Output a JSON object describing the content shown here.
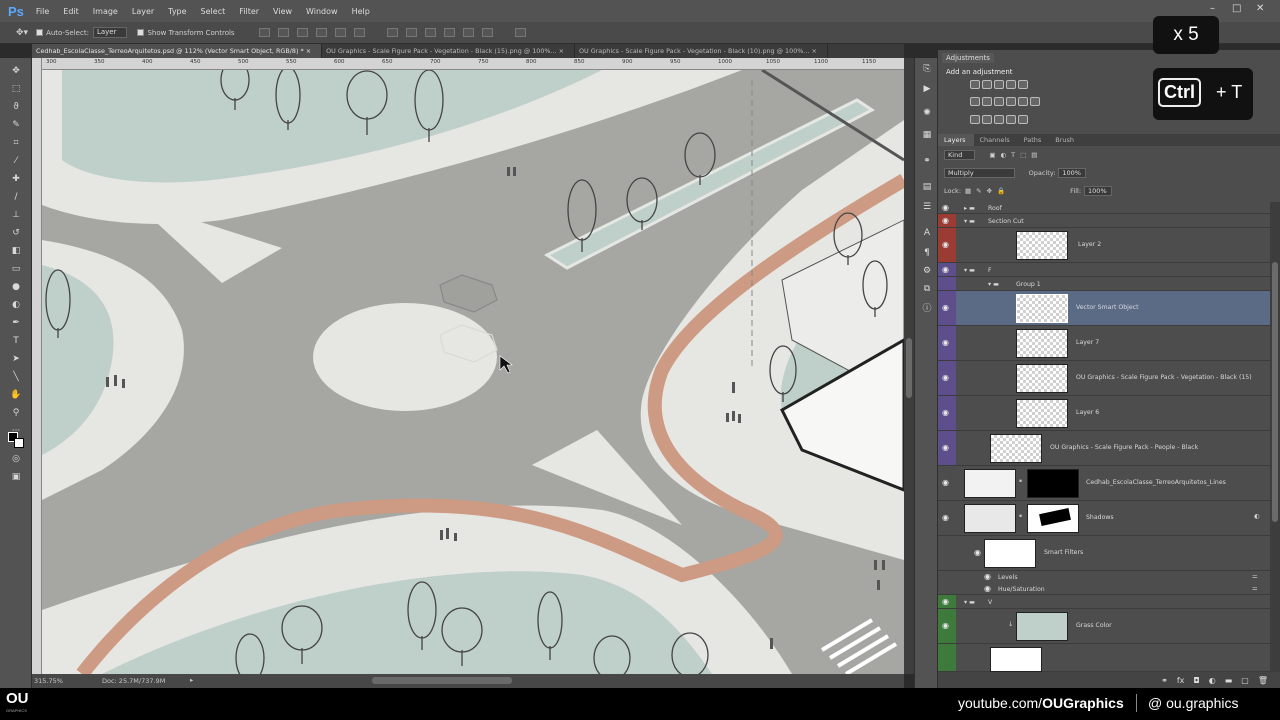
{
  "app": {
    "logo": "Ps"
  },
  "menu": [
    "File",
    "Edit",
    "Image",
    "Layer",
    "Type",
    "Select",
    "Filter",
    "View",
    "Window",
    "Help"
  ],
  "options": {
    "auto_select_label": "Auto-Select:",
    "auto_select_value": "Layer",
    "show_transform_label": "Show Transform Controls"
  },
  "doc_tabs": [
    "Cedhab_EscolaClasse_TerreoArquitetos.psd @ 112% (Vector Smart Object, RGB/8) *",
    "OU Graphics - Scale Figure Pack - Vegetation - Black (15).png @ 100%...",
    "OU Graphics - Scale Figure Pack - Vegetation - Black (10).png @ 100%..."
  ],
  "ruler_ticks": [
    "300",
    "350",
    "400",
    "450",
    "500",
    "550",
    "600",
    "650",
    "700",
    "750",
    "800",
    "850",
    "900",
    "950",
    "1000",
    "1050",
    "1100",
    "1150"
  ],
  "status": {
    "zoom": "315.75%",
    "doc": "Doc: 25.7M/737.9M"
  },
  "adjustments": {
    "tab": "Adjustments",
    "title": "Add an adjustment"
  },
  "layers_panel": {
    "tabs": [
      "Layers",
      "Channels",
      "Paths",
      "Brush"
    ],
    "kind": "Kind",
    "blend": "Multiply",
    "opacity_label": "Opacity:",
    "opacity": "100%",
    "lock_label": "Lock:",
    "fill_label": "Fill:",
    "fill": "100%"
  },
  "layers": [
    {
      "name": "Roof"
    },
    {
      "name": "Section Cut"
    },
    {
      "name": "Layer 2"
    },
    {
      "name": "F"
    },
    {
      "name": "Group 1"
    },
    {
      "name": "Vector Smart Object"
    },
    {
      "name": "Layer 7"
    },
    {
      "name": "OU Graphics - Scale Figure Pack - Vegetation - Black (15)"
    },
    {
      "name": "Layer 6"
    },
    {
      "name": "OU Graphics - Scale Figure Pack - People - Black"
    },
    {
      "name": "Cedhab_EscolaClasse_TerreoArquitetos_Lines"
    },
    {
      "name": "Shadows"
    },
    {
      "name": "Smart Filters"
    },
    {
      "name": "Levels"
    },
    {
      "name": "Hue/Saturation"
    },
    {
      "name": "V"
    },
    {
      "name": "Grass Color"
    }
  ],
  "overlay": {
    "multiplier": "x 5",
    "key_ctrl": "Ctrl",
    "key_plus_t": "+ T"
  },
  "footer": {
    "logo": "OU",
    "logo_sub": "GRAPHICS",
    "youtube_prefix": "youtube.com/",
    "youtube_channel": "OUGraphics",
    "instagram": "@ ou.graphics"
  },
  "colors": {
    "path": "#cd9a84",
    "grass": "#bfcfca",
    "road": "#a6a6a2",
    "pavement": "#e6e6e2",
    "accent": "#5aa7ff"
  }
}
